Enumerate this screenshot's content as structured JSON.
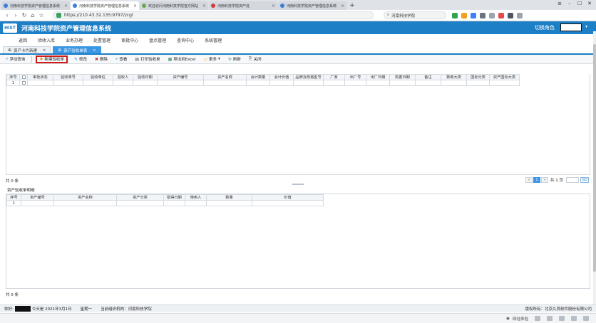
{
  "browser": {
    "tabs": [
      {
        "label": "河南科技学院资产管理信息系统",
        "color": "#3d7bd9"
      },
      {
        "label": "河南科技学院资产管理信息系统",
        "color": "#3d7bd9",
        "active": true
      },
      {
        "label": "欢迎访问河南科技学院官方网站",
        "color": "#6aa84f"
      },
      {
        "label": "河南科技学院资产处",
        "color": "#d63b3b"
      },
      {
        "label": "河南科技学院资产管理信息系统",
        "color": "#3d7bd9"
      }
    ],
    "new_tab": "+",
    "url": "https://210.43.32.135:9797/zcgl",
    "search_text": "河南科技学院",
    "bottom_text": "网址体验"
  },
  "app": {
    "logo": "HIST",
    "title": "河南科技学院资产管理信息系统",
    "role_label": "切换角色"
  },
  "menu": [
    "返回",
    "验收入库",
    "业务办理",
    "处置管理",
    "审批中心",
    "盘点管理",
    "查询中心",
    "系统管理"
  ],
  "page_tabs": [
    {
      "label": "资产卡片新建",
      "icon": "⊕"
    },
    {
      "label": "资产验收单表",
      "icon": "⊕",
      "active": true
    }
  ],
  "toolbar": {
    "float_query": "浮动查询",
    "new_receipt": "新建验收单",
    "edit": "修改",
    "delete": "删除",
    "view": "查看",
    "print": "打印验收单",
    "export": "导出到Excel",
    "more": "更多",
    "refresh": "刷新",
    "close": "关闭"
  },
  "main_grid": {
    "headers": [
      "序号",
      "",
      "审批状态",
      "验收单号",
      "验收单位",
      "验收人",
      "验收日期",
      "资产编号",
      "资产名称",
      "会计数量",
      "会计价值",
      "品牌及规格型号",
      "厂家",
      "出厂号",
      "出厂日期",
      "购置日期",
      "备注",
      "数离大类",
      "国标分类",
      "资产国标大类"
    ],
    "rows": [
      [
        "1",
        "",
        "",
        "",
        "",
        "",
        "",
        "",
        "",
        "",
        "",
        "",
        "",
        "",
        "",
        "",
        "",
        "",
        "",
        ""
      ]
    ],
    "total": "共 0 条"
  },
  "pager": {
    "first": "«",
    "page": "1",
    "last": "»",
    "page_label": "共 1 页",
    "go": "GO"
  },
  "sub_title": "资产验收单明细",
  "sub_grid": {
    "headers": [
      "序号",
      "资产编号",
      "资产名称",
      "资产分类",
      "取得日期",
      "使用人",
      "数量",
      "价值"
    ],
    "rows": [
      [
        "1",
        "",
        "",
        "",
        "",
        "",
        "",
        ""
      ]
    ],
    "total": "共 0 条"
  },
  "status_bar": {
    "prefix": "你好:",
    "today": "今天是 2021年3月1日",
    "weekday": "星期一",
    "org": "当前组织机构：河南科技学院",
    "copyright": "版权所有：北京久其软件股份有限公司"
  }
}
